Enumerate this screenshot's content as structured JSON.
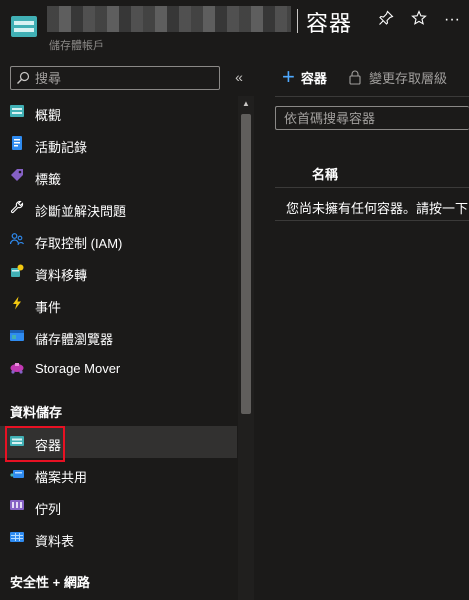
{
  "header": {
    "resource_type": "儲存體帳戶",
    "page_title": "容器",
    "pin_icon": "pin-icon",
    "star_icon": "star-icon",
    "more_label": "···"
  },
  "sidebar": {
    "search_placeholder": "搜尋",
    "collapse_label": "«",
    "items": [
      {
        "label": "概觀",
        "icon": "overview-icon"
      },
      {
        "label": "活動記錄",
        "icon": "activity-log-icon"
      },
      {
        "label": "標籤",
        "icon": "tag-icon"
      },
      {
        "label": "診斷並解決問題",
        "icon": "wrench-icon"
      },
      {
        "label": "存取控制 (IAM)",
        "icon": "people-icon"
      },
      {
        "label": "資料移轉",
        "icon": "data-migration-icon"
      },
      {
        "label": "事件",
        "icon": "lightning-icon"
      },
      {
        "label": "儲存體瀏覽器",
        "icon": "storage-browser-icon"
      },
      {
        "label": "Storage Mover",
        "icon": "storage-mover-icon"
      }
    ],
    "section_data_storage": "資料儲存",
    "storage_items": [
      {
        "label": "容器",
        "icon": "container-icon",
        "selected": true
      },
      {
        "label": "檔案共用",
        "icon": "file-share-icon"
      },
      {
        "label": "佇列",
        "icon": "queue-icon"
      },
      {
        "label": "資料表",
        "icon": "table-icon"
      }
    ],
    "section_security": "安全性 + 網路"
  },
  "toolbar": {
    "add_label": "容器",
    "change_access_label": "變更存取層級"
  },
  "filter": {
    "placeholder": "依首碼搜尋容器"
  },
  "table": {
    "column_name": "名稱",
    "empty_message": "您尚未擁有任何容器。請按一下"
  },
  "colors": {
    "accent": "#4ea9ff",
    "highlight": "#e81123",
    "background": "#1b1a19"
  }
}
